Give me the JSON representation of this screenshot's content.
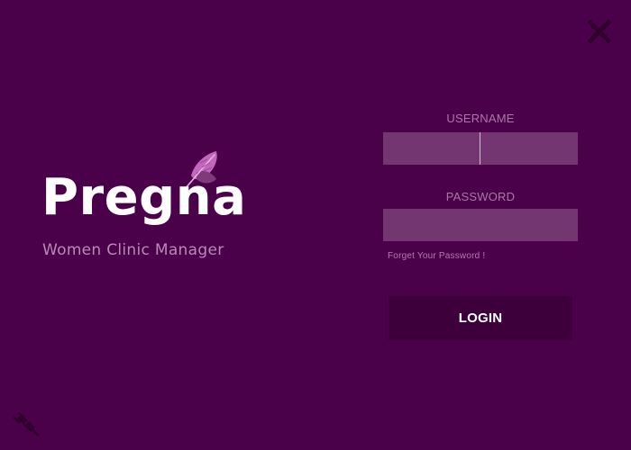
{
  "window": {
    "close_label": "X",
    "close_icon": "close-icon",
    "background_color": "#4b004a"
  },
  "brand": {
    "name": "Pregna",
    "tagline": "Women Clinic Manager",
    "logo_icon": "feather-icon",
    "accent_color": "#c267bd"
  },
  "login_form": {
    "username_label": "USERNAME",
    "username_value": "",
    "password_label": "PASSWORD",
    "password_value": "",
    "forgot_password": "Forget Your Password !",
    "login_button": "LOGIN"
  },
  "footer": {
    "connection_icon": "plug-icon"
  }
}
